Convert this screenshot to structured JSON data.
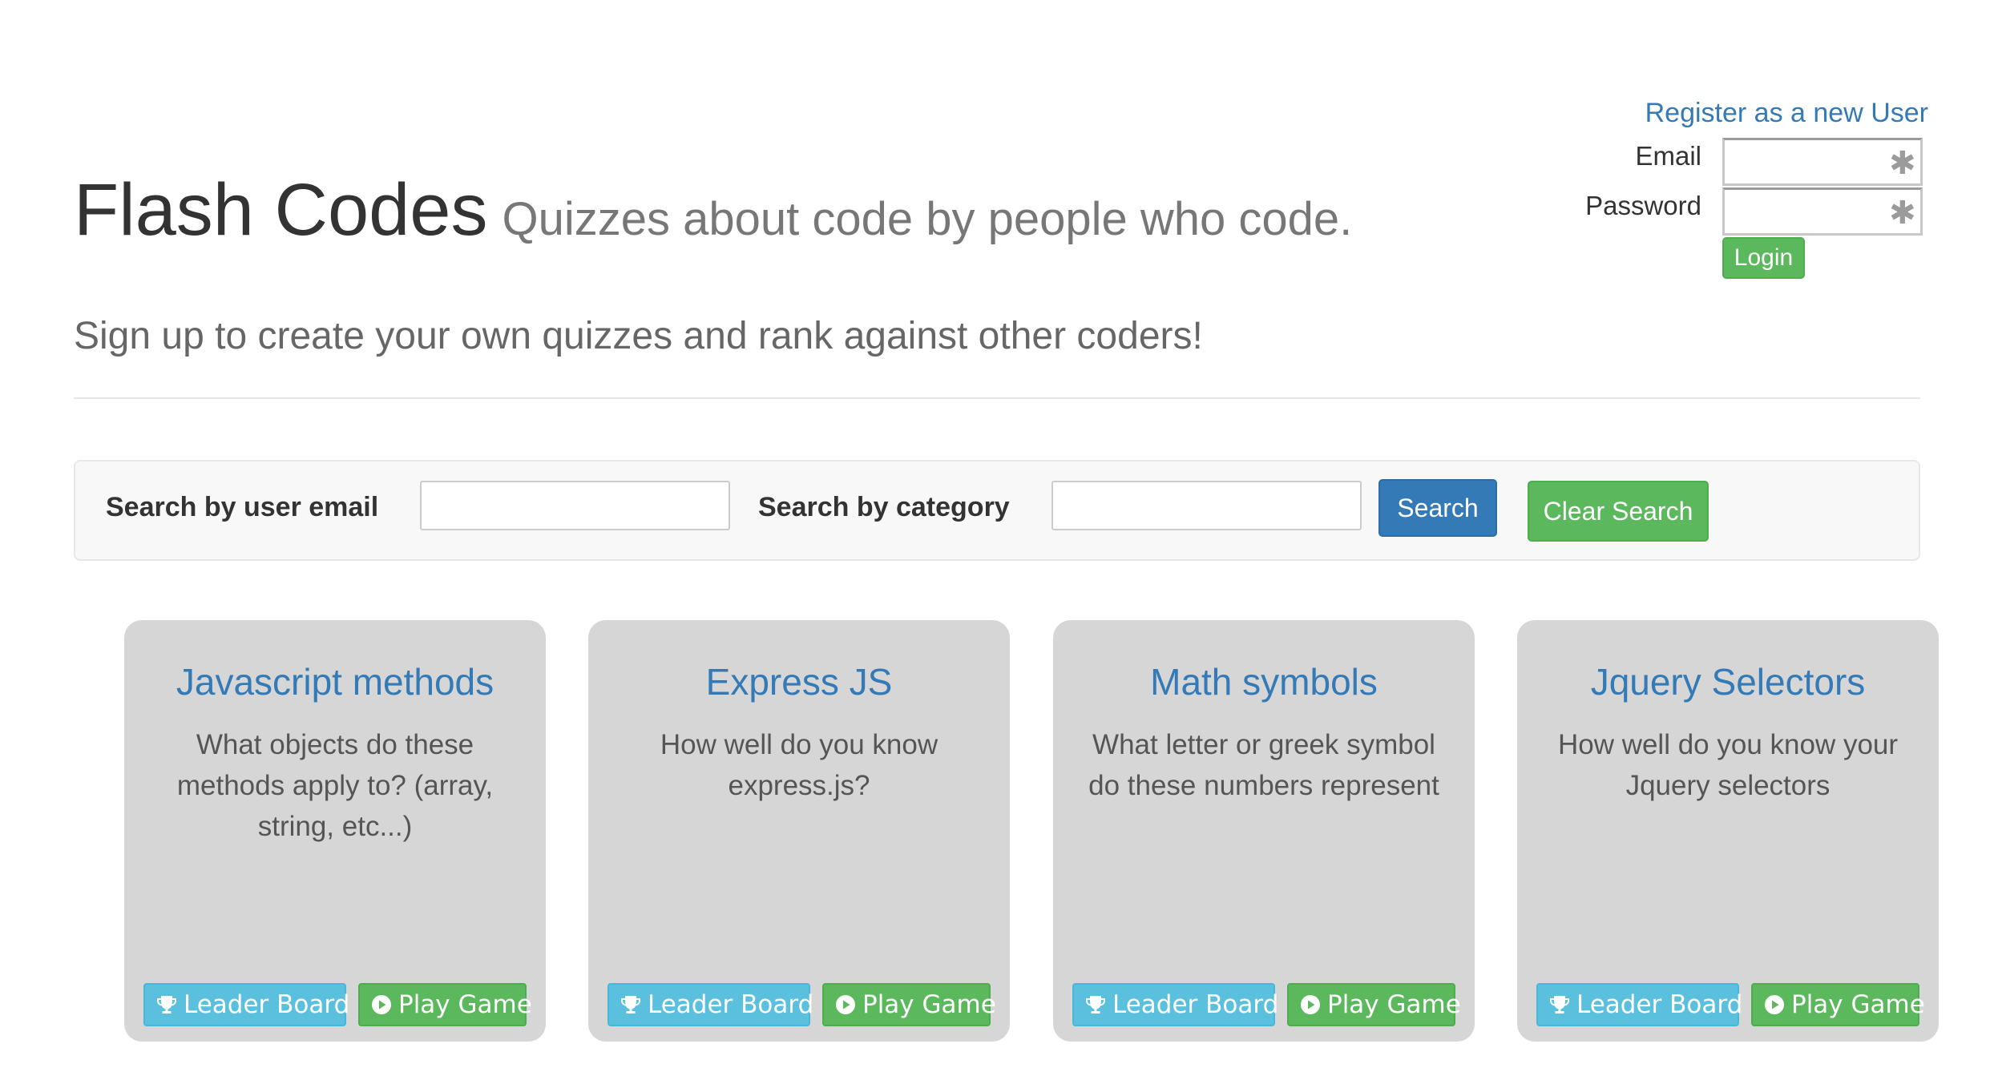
{
  "auth": {
    "register_link": "Register as a new User",
    "email_label": "Email",
    "password_label": "Password",
    "required_marker": "✱",
    "login_label": "Login"
  },
  "header": {
    "title": "Flash Codes",
    "tagline": "Quizzes about code by people who code.",
    "signup_text": "Sign up to create your own quizzes and rank against other coders!"
  },
  "search": {
    "email_label": "Search by user email",
    "category_label": "Search by category",
    "email_value": "",
    "category_value": "",
    "search_button": "Search",
    "clear_button": "Clear Search"
  },
  "cards": [
    {
      "title": "Javascript methods",
      "description": "What objects do these methods apply to? (array, string, etc...)",
      "leader_label": "Leader Board",
      "play_label": "Play Game"
    },
    {
      "title": "Express JS",
      "description": "How well do you know express.js?",
      "leader_label": "Leader Board",
      "play_label": "Play Game"
    },
    {
      "title": "Math symbols",
      "description": "What letter or greek symbol do these numbers represent",
      "leader_label": "Leader Board",
      "play_label": "Play Game"
    },
    {
      "title": "Jquery Selectors",
      "description": "How well do you know your Jquery selectors",
      "leader_label": "Leader Board",
      "play_label": "Play Game"
    }
  ],
  "icons": {
    "leader_board": "trophy-icon",
    "play_game": "play-circle-icon",
    "required": "asterisk-icon"
  },
  "colors": {
    "link": "#337ab7",
    "primary_button": "#337ab7",
    "success_button": "#5cb85c",
    "info_button": "#5bc0de",
    "card_background": "#d6d6d6"
  }
}
